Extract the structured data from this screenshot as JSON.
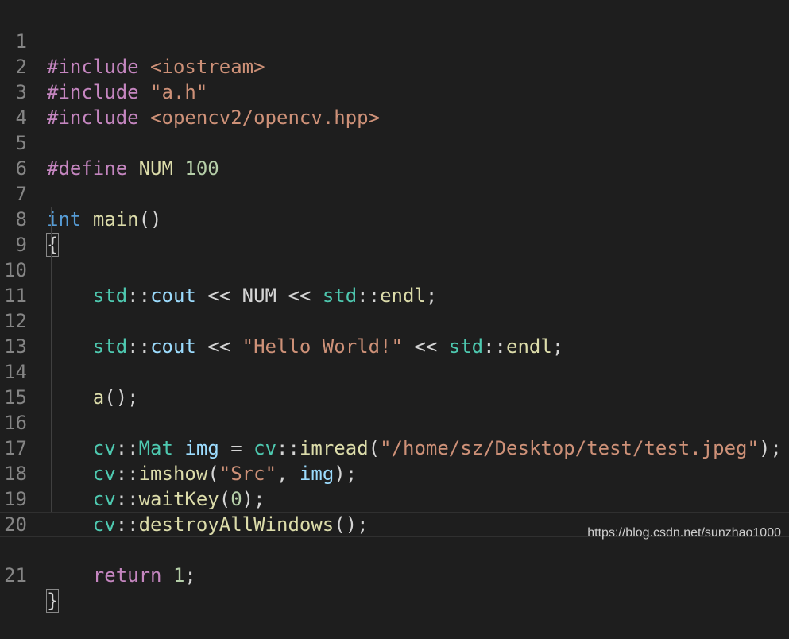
{
  "editor": {
    "lines": [
      {
        "n": "1"
      },
      {
        "n": "2"
      },
      {
        "n": "3"
      },
      {
        "n": "4"
      },
      {
        "n": "5"
      },
      {
        "n": "6"
      },
      {
        "n": "7"
      },
      {
        "n": "8"
      },
      {
        "n": "9"
      },
      {
        "n": "10"
      },
      {
        "n": "11"
      },
      {
        "n": "12"
      },
      {
        "n": "13"
      },
      {
        "n": "14"
      },
      {
        "n": "15"
      },
      {
        "n": "16"
      },
      {
        "n": "17"
      },
      {
        "n": "18"
      },
      {
        "n": "19"
      },
      {
        "n": "20"
      },
      {
        "n": "21"
      }
    ],
    "tokens": {
      "l1": [
        "#include",
        " ",
        "<iostream>"
      ],
      "l2": [
        "#include",
        " ",
        "\"a.h\""
      ],
      "l3": [
        "#include",
        " ",
        "<opencv2/opencv.hpp>"
      ],
      "l5": [
        "#define",
        " NUM ",
        "100"
      ],
      "l7": [
        "int",
        " ",
        "main",
        "()"
      ],
      "l8": [
        "{"
      ],
      "l9": [
        "    ",
        "std",
        "::",
        "cout",
        " << NUM << ",
        "std",
        "::",
        "endl",
        ";"
      ],
      "l11": [
        "    ",
        "std",
        "::",
        "cout",
        " << ",
        "\"Hello World!\"",
        " << ",
        "std",
        "::",
        "endl",
        ";"
      ],
      "l13": [
        "    ",
        "a",
        "();"
      ],
      "l15": [
        "    ",
        "cv",
        "::",
        "Mat",
        " ",
        "img",
        " = ",
        "cv",
        "::",
        "imread",
        "(",
        "\"/home/sz/Desktop/test/test.jpeg\"",
        ");"
      ],
      "l16": [
        "    ",
        "cv",
        "::",
        "imshow",
        "(",
        "\"Src\"",
        ", ",
        "img",
        ");"
      ],
      "l17": [
        "    ",
        "cv",
        "::",
        "waitKey",
        "(",
        "0",
        ");"
      ],
      "l18": [
        "    ",
        "cv",
        "::",
        "destroyAllWindows",
        "();"
      ],
      "l20": [
        "    ",
        "return",
        " ",
        "1",
        ";"
      ],
      "l21": [
        "}"
      ]
    }
  },
  "watermark": "https://blog.csdn.net/sunzhao1000",
  "colors": {
    "background": "#1e1e1e",
    "keyword": "#c586c0",
    "type": "#569cd6",
    "namespace": "#4ec9b0",
    "variable": "#9cdcfe",
    "function": "#dcdcaa",
    "string": "#ce9178",
    "number": "#b5cea8",
    "plain": "#d4d4d4",
    "line_number": "#858585"
  }
}
